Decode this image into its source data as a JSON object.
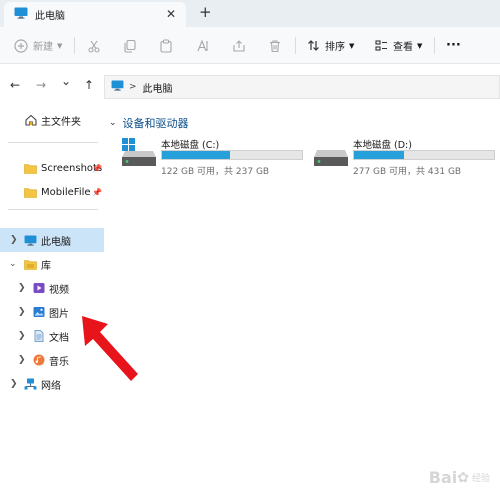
{
  "window": {
    "tab_title": "此电脑",
    "close_glyph": "✕",
    "new_tab_glyph": "+"
  },
  "toolbar": {
    "new_label": "新建",
    "sort_label": "排序",
    "view_label": "查看",
    "more_glyph": "···"
  },
  "nav": {
    "back_glyph": "←",
    "forward_glyph": "→",
    "dropdown_glyph": "⌄",
    "up_glyph": "↑",
    "address_separator": ">",
    "address_location": "此电脑"
  },
  "sidebar": {
    "home": "主文件夹",
    "pinned": [
      {
        "label": "Screenshots"
      },
      {
        "label": "MobileFile"
      }
    ],
    "this_pc": "此电脑",
    "library": "库",
    "library_children": [
      {
        "label": "视频"
      },
      {
        "label": "图片"
      },
      {
        "label": "文档"
      },
      {
        "label": "音乐"
      }
    ],
    "network": "网络"
  },
  "main": {
    "group_title": "设备和驱动器",
    "drives": [
      {
        "name": "本地磁盘 (C:)",
        "info": "122 GB 可用，共 237 GB",
        "used_fraction": 0.485
      },
      {
        "name": "本地磁盘 (D:)",
        "info": "277 GB 可用，共 431 GB",
        "used_fraction": 0.357
      }
    ]
  },
  "watermark": {
    "text": "Bai",
    "sub": "经验"
  },
  "colors": {
    "accent": "#26a0da",
    "selected": "#cce4f7",
    "annotation_arrow": "#e8141c"
  }
}
